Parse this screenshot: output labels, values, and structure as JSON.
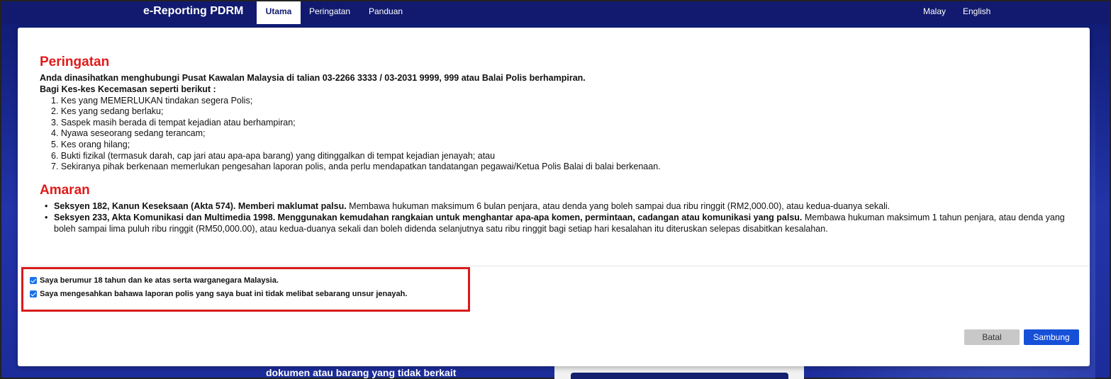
{
  "nav": {
    "brand": "e-Reporting PDRM",
    "tabs": [
      "Utama",
      "Peringatan",
      "Panduan"
    ],
    "lang": [
      "Malay",
      "English"
    ]
  },
  "background": {
    "text": "dokumen atau barang yang tidak berkait"
  },
  "modal": {
    "peringatan_title": "Peringatan",
    "intro": "Anda dinasihatkan menghubungi Pusat Kawalan Malaysia di talian 03-2266 3333 / 03-2031 9999, 999 atau Balai Polis berhampiran.",
    "subheading": "Bagi Kes-kes Kecemasan seperti berikut :",
    "cases": [
      "1. Kes yang MEMERLUKAN tindakan segera Polis;",
      "2. Kes yang sedang berlaku;",
      "3. Saspek masih berada di tempat kejadian atau berhampiran;",
      "4. Nyawa seseorang sedang terancam;",
      "5. Kes orang hilang;",
      "6. Bukti fizikal (termasuk darah, cap jari atau apa-apa barang) yang ditinggalkan di tempat kejadian jenayah; atau",
      "7. Sekiranya pihak berkenaan memerlukan pengesahan laporan polis, anda perlu mendapatkan tandatangan pegawai/Ketua Polis Balai di balai berkenaan."
    ],
    "amaran_title": "Amaran",
    "warnings": [
      {
        "bold": "Seksyen 182, Kanun Keseksaan (Akta 574). Memberi maklumat palsu.",
        "text": " Membawa hukuman maksimum 6 bulan penjara, atau denda yang boleh sampai dua ribu ringgit (RM2,000.00), atau kedua-duanya sekali."
      },
      {
        "bold": "Seksyen 233, Akta Komunikasi dan Multimedia 1998. Menggunakan kemudahan rangkaian untuk menghantar apa-apa komen, permintaan, cadangan atau komunikasi yang palsu.",
        "text": " Membawa hukuman maksimum 1 tahun penjara, atau denda yang boleh sampai lima puluh ribu ringgit (RM50,000.00), atau kedua-duanya sekali dan boleh didenda selanjutnya satu ribu ringgit bagi setiap hari kesalahan itu diteruskan selepas disabitkan kesalahan."
      }
    ],
    "checkboxes": [
      {
        "label": "Saya berumur 18 tahun dan ke atas serta warganegara Malaysia.",
        "checked": true
      },
      {
        "label": "Saya mengesahkan bahawa laporan polis yang saya buat ini tidak melibat sebarang unsur jenayah.",
        "checked": true
      }
    ],
    "buttons": {
      "cancel": "Batal",
      "continue": "Sambung"
    }
  }
}
